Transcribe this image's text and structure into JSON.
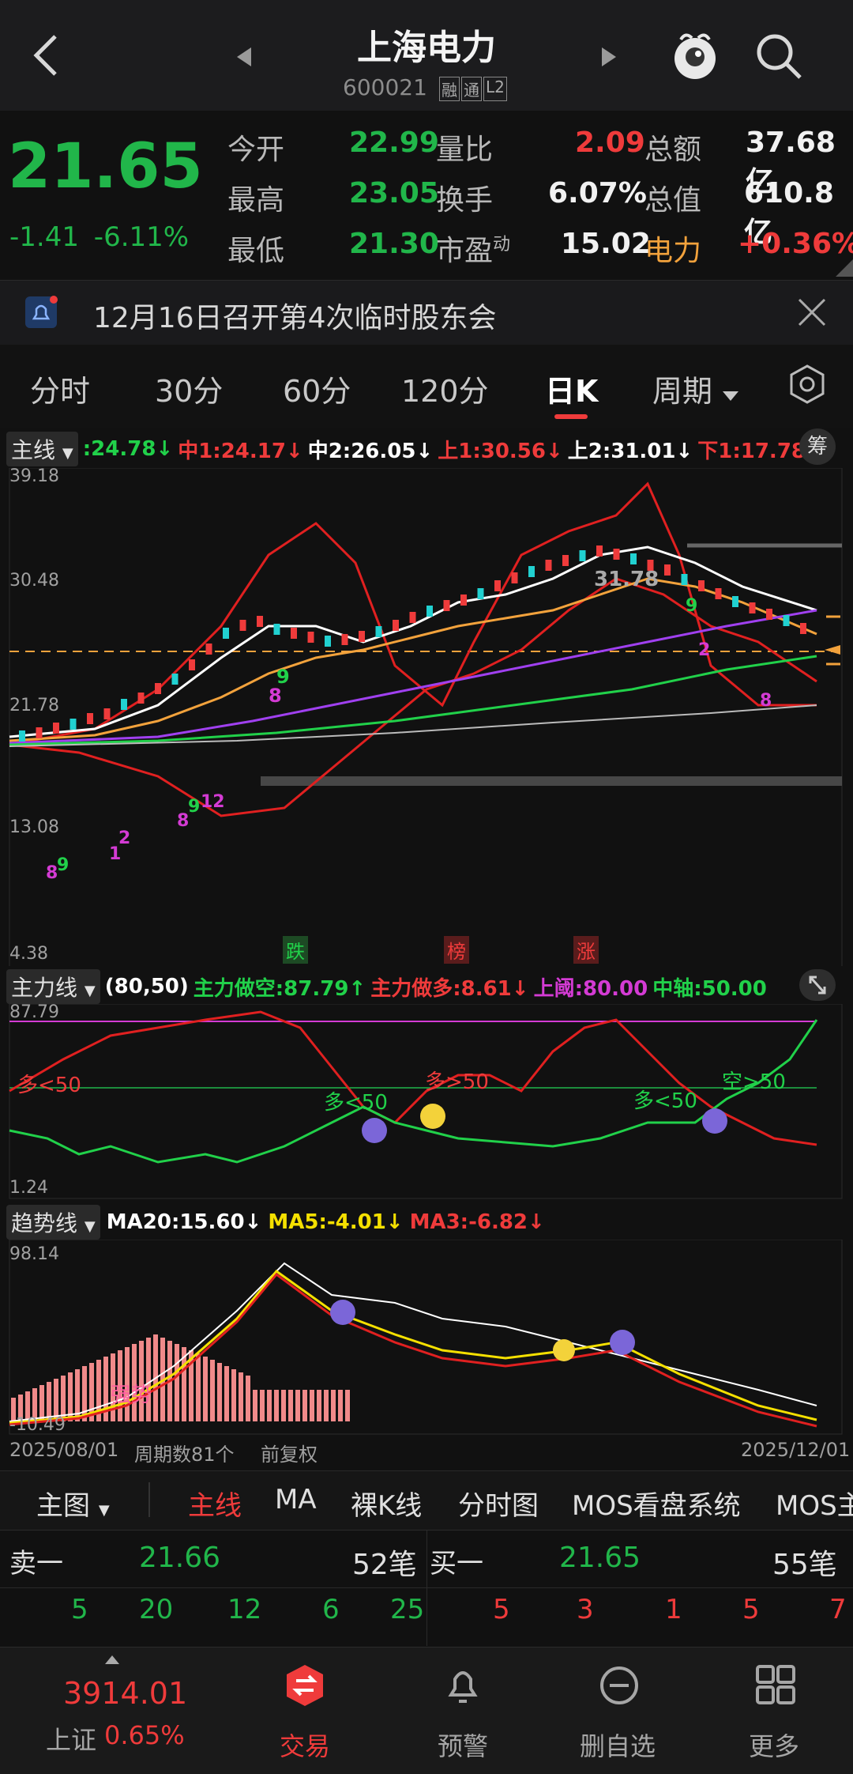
{
  "header": {
    "title": "上海电力",
    "code": "600021",
    "badges": [
      "融",
      "通",
      "L2"
    ]
  },
  "quote": {
    "price": "21.65",
    "change": "-1.41",
    "change_pct": "-6.11%",
    "rows": [
      [
        {
          "label": "今开",
          "value": "22.99",
          "color": "green"
        },
        {
          "label": "量比",
          "value": "2.09",
          "color": "red"
        },
        {
          "label": "总额",
          "value": "37.68亿",
          "color": "white"
        }
      ],
      [
        {
          "label": "最高",
          "value": "23.05",
          "color": "green"
        },
        {
          "label": "换手",
          "value": "6.07%",
          "color": "white"
        },
        {
          "label": "总值",
          "value": "610.8亿",
          "color": "white"
        }
      ],
      [
        {
          "label": "最低",
          "value": "21.30",
          "color": "green"
        },
        {
          "label": "市盈",
          "sup": "动",
          "value": "15.02",
          "color": "white"
        },
        {
          "label": "电力",
          "value": "+0.36%",
          "color": "red"
        }
      ]
    ]
  },
  "notice": {
    "text": "12月16日召开第4次临时股东会"
  },
  "period_tabs": [
    "分时",
    "30分",
    "60分",
    "120分",
    "日K",
    "周期"
  ],
  "active_tab": "日K",
  "main_chart": {
    "indicator": "主线",
    "legend": [
      {
        "text": ":24.78↓",
        "color": "#21d14a"
      },
      {
        "text": "中1:24.17↓",
        "color": "#ef3b3b"
      },
      {
        "text": "中2:26.05↓",
        "color": "#ffffff"
      },
      {
        "text": "上1:30.56↓",
        "color": "#ef3b3b"
      },
      {
        "text": "上2:31.01↓",
        "color": "#ffffff"
      },
      {
        "text": "下1:17.78↓",
        "color": "#ef3b3b"
      }
    ],
    "chip_button": "筹",
    "y_ticks": [
      "39.18",
      "30.48",
      "21.78",
      "13.08",
      "4.38"
    ],
    "annotations": {
      "high": "31.78",
      "markers": [
        "跌",
        "榜",
        "涨"
      ]
    },
    "signal_numbers": [
      "9",
      "8",
      "9",
      "1",
      "2",
      "8",
      "9",
      "12",
      "8",
      "9",
      "2",
      "8"
    ]
  },
  "power_chart": {
    "indicator": "主力线",
    "legend": [
      {
        "text": "(80,50)",
        "color": "#ffffff"
      },
      {
        "text": "主力做空:87.79↑",
        "color": "#21d14a"
      },
      {
        "text": "主力做多:8.61↓",
        "color": "#ef3b3b"
      },
      {
        "text": "上阈:80.00",
        "color": "#d43bd4"
      },
      {
        "text": "中轴:50.00",
        "color": "#21d14a"
      }
    ],
    "y_ticks": [
      "87.79",
      "1.24"
    ],
    "labels": [
      {
        "text": "多<50",
        "color": "#ef3b3b"
      },
      {
        "text": "多<50",
        "color": "#21d14a"
      },
      {
        "text": "多>50",
        "color": "#ef3b3b"
      },
      {
        "text": "多<50",
        "color": "#21d14a"
      },
      {
        "text": "空>50",
        "color": "#21d14a"
      }
    ]
  },
  "trend_chart": {
    "indicator": "趋势线",
    "legend": [
      {
        "text": "MA20:15.60↓",
        "color": "#ffffff"
      },
      {
        "text": "MA5:-4.01↓",
        "color": "#f5e000"
      },
      {
        "text": "MA3:-6.82↓",
        "color": "#ef3b3b"
      }
    ],
    "y_ticks": [
      "98.14",
      "-10.49"
    ],
    "strength_label": "强势"
  },
  "footer_axis": {
    "start": "2025/08/01",
    "period_count": "周期数81个",
    "adjust": "前复权",
    "end": "2025/12/01"
  },
  "chart_tabs": [
    "主图",
    "主线",
    "MA",
    "裸K线",
    "分时图",
    "MOS看盘系统",
    "MOS主"
  ],
  "order_book": {
    "sell": {
      "label": "卖一",
      "price": "21.66",
      "count": "52笔",
      "queue": [
        "5",
        "20",
        "12",
        "6",
        "25"
      ]
    },
    "buy": {
      "label": "买一",
      "price": "21.65",
      "count": "55笔",
      "queue": [
        "5",
        "3",
        "1",
        "5",
        "7"
      ]
    }
  },
  "index": {
    "value": "3914.01",
    "name": "上证",
    "pct": "0.65%"
  },
  "nav": [
    {
      "label": "交易",
      "icon": "trade-icon",
      "active": true
    },
    {
      "label": "预警",
      "icon": "bell-icon",
      "active": false
    },
    {
      "label": "删自选",
      "icon": "minus-circle-icon",
      "active": false
    },
    {
      "label": "更多",
      "icon": "grid-icon",
      "active": false
    }
  ],
  "chart_data": {
    "type": "line",
    "title": "",
    "x": [
      "2025/08/01",
      "2025/12/01"
    ],
    "ylim": [
      4.38,
      39.18
    ],
    "series": [
      {
        "name": "中1",
        "last": 24.17
      },
      {
        "name": "中2",
        "last": 26.05
      },
      {
        "name": "上1",
        "last": 30.56
      },
      {
        "name": "上2",
        "last": 31.01
      },
      {
        "name": "下1",
        "last": 17.78
      }
    ]
  }
}
